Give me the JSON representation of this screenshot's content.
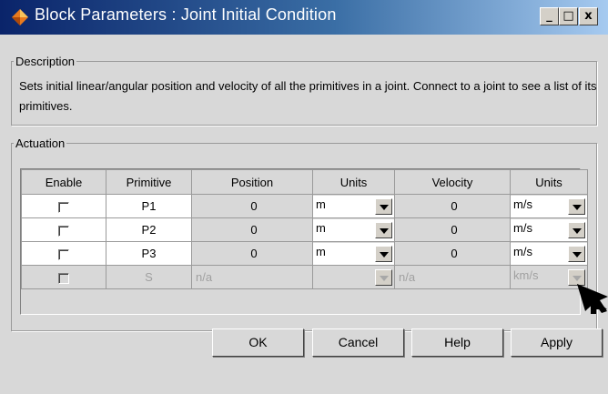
{
  "window": {
    "title": "Block Parameters : Joint Initial Condition",
    "controls": [
      "_",
      "□",
      "x"
    ]
  },
  "description": {
    "legend": "Description",
    "text": "Sets initial linear/angular position and velocity of all the primitives in a joint. Connect to a joint to see a list of its primitives."
  },
  "actuation": {
    "legend": "Actuation",
    "columns": [
      "Enable",
      "Primitive",
      "Position",
      "Units",
      "Velocity",
      "Units"
    ],
    "rows": [
      {
        "primitive": "P1",
        "position": "0",
        "position_units": "m",
        "velocity": "0",
        "velocity_units": "m/s",
        "enabled": true
      },
      {
        "primitive": "P2",
        "position": "0",
        "position_units": "m",
        "velocity": "0",
        "velocity_units": "m/s",
        "enabled": true
      },
      {
        "primitive": "P3",
        "position": "0",
        "position_units": "m",
        "velocity": "0",
        "velocity_units": "m/s",
        "enabled": true
      },
      {
        "primitive": "S",
        "position": "n/a",
        "position_units": "",
        "velocity": "n/a",
        "velocity_units": "km/s",
        "enabled": false
      }
    ]
  },
  "buttons": {
    "ok": "OK",
    "cancel": "Cancel",
    "help": "Help",
    "apply": "Apply"
  },
  "colors": {
    "title_start": "#0a246a",
    "title_end": "#a6caf0",
    "background": "#d8d8d8"
  }
}
